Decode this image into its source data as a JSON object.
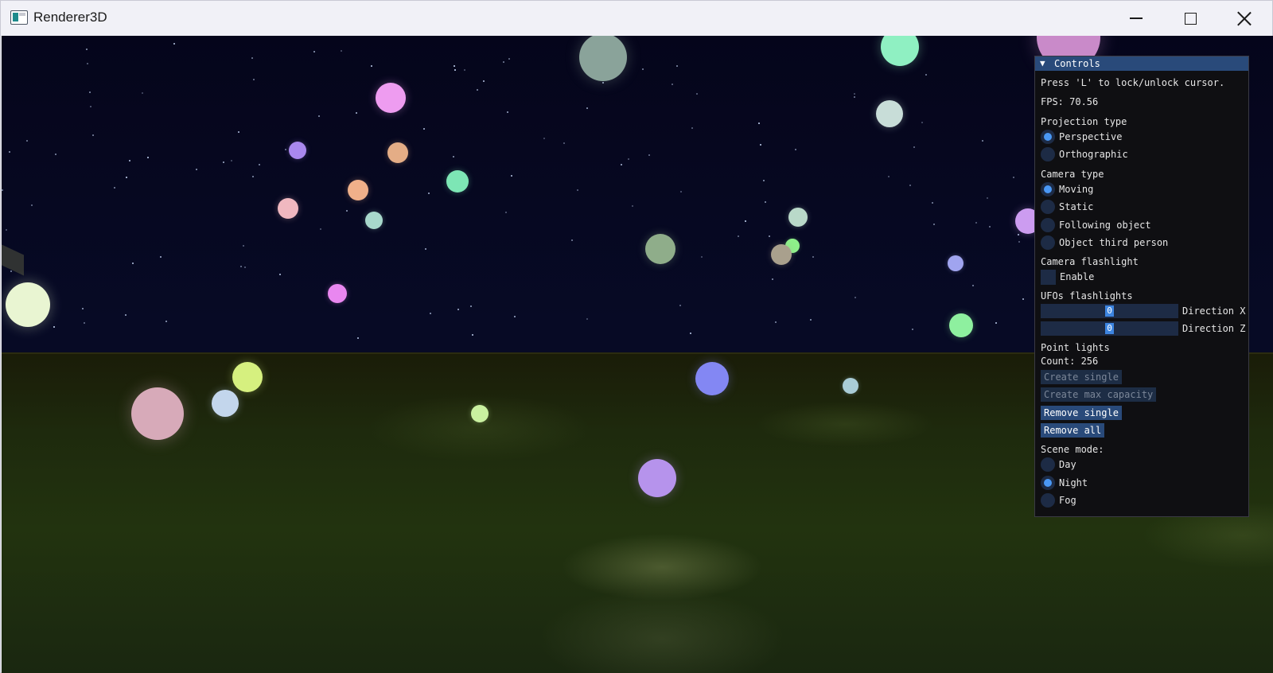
{
  "window": {
    "title": "Renderer3D",
    "minimize_icon": "minimize-icon",
    "maximize_icon": "maximize-icon",
    "close_icon": "close-icon"
  },
  "controls": {
    "header": "Controls",
    "collapse_arrow": "▼",
    "hint": "Press 'L' to lock/unlock cursor.",
    "fps": "FPS: 70.56",
    "projection": {
      "label": "Projection type",
      "options": [
        {
          "label": "Perspective",
          "selected": true
        },
        {
          "label": "Orthographic",
          "selected": false
        }
      ]
    },
    "camera": {
      "label": "Camera type",
      "options": [
        {
          "label": "Moving",
          "selected": true
        },
        {
          "label": "Static",
          "selected": false
        },
        {
          "label": "Following object",
          "selected": false
        },
        {
          "label": "Object third person",
          "selected": false
        }
      ]
    },
    "flashlight": {
      "label": "Camera flashlight",
      "enable_label": "Enable",
      "enabled": false
    },
    "ufo": {
      "label": "UFOs flashlights",
      "direction_x": {
        "label": "Direction X",
        "value": "0"
      },
      "direction_z": {
        "label": "Direction Z",
        "value": "0"
      }
    },
    "point_lights": {
      "label": "Point lights",
      "count": "Count: 256",
      "create_single": "Create single",
      "create_max": "Create max capacity",
      "remove_single": "Remove single",
      "remove_all": "Remove all"
    },
    "scene": {
      "label": "Scene mode:",
      "options": [
        {
          "label": "Day",
          "selected": false
        },
        {
          "label": "Night",
          "selected": true
        },
        {
          "label": "Fog",
          "selected": false
        }
      ]
    }
  },
  "colors": {
    "panel_bg": "#0f0f12",
    "header": "#294a7a",
    "radio_active": "#4a98f5",
    "frame_bg": "#1d2b45"
  }
}
